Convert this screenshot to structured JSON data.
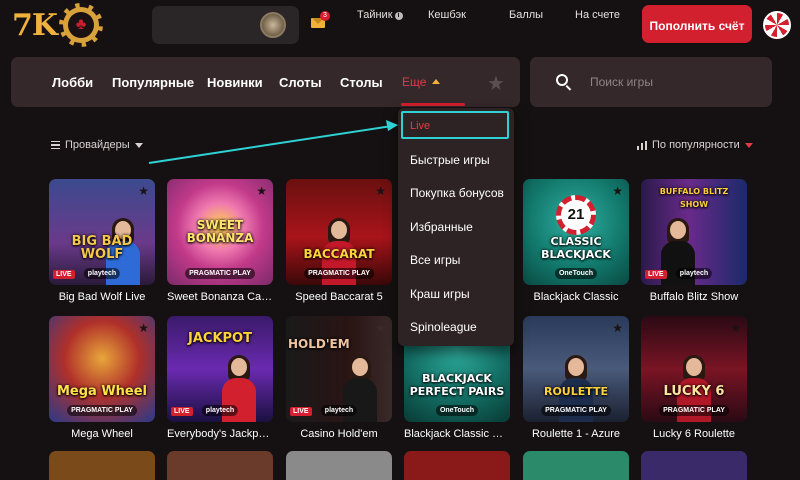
{
  "header": {
    "logo_text": "7K",
    "nav": [
      "Тайник",
      "Кешбэк",
      "Баллы",
      "На счете"
    ],
    "mail_badge": "3",
    "deposit_label": "Пополнить счёт"
  },
  "nav": {
    "items": [
      "Лобби",
      "Популярные",
      "Новинки",
      "Слоты",
      "Столы"
    ],
    "more": "Еще"
  },
  "search": {
    "placeholder": "Поиск игры"
  },
  "filters": {
    "providers": "Провайдеры",
    "sort": "По популярности"
  },
  "dropdown": {
    "items": [
      "Live",
      "Быстрые игры",
      "Покупка бонусов",
      "Избранные",
      "Все игры",
      "Краш игры",
      "Spinoleague"
    ],
    "highlight_color": "#2fd2d4"
  },
  "games": [
    {
      "name": "Big Bad Wolf Live",
      "title": "BIG BAD WOLF",
      "provider": "playtech",
      "live": true
    },
    {
      "name": "Sweet Bonanza Candy...",
      "title": "SWEET BONANZA",
      "provider": "PRAGMATIC PLAY",
      "live": false
    },
    {
      "name": "Speed Baccarat 5",
      "title": "BACCARAT",
      "provider": "PRAGMATIC PLAY",
      "live": false
    },
    {
      "name": "Blackjack Classic",
      "title": "CLASSIC BLACKJACK",
      "provider": "OneTouch",
      "live": false
    },
    {
      "name": "Buffalo Blitz Show",
      "title": "BUFFALO BLITZ SHOW",
      "provider": "playtech",
      "live": true
    },
    {
      "name": "Mega Wheel",
      "title": "Mega Wheel",
      "provider": "PRAGMATIC PLAY",
      "live": false
    },
    {
      "name": "Everybody's Jackpot Li...",
      "title": "JACKPOT",
      "provider": "playtech",
      "live": true
    },
    {
      "name": "Casino Hold'em",
      "title": "HOLD'EM",
      "provider": "playtech",
      "live": true
    },
    {
      "name": "Blackjack Classic Perf...",
      "title": "BLACKJACK PERFECT PAIRS",
      "provider": "OneTouch",
      "live": false
    },
    {
      "name": "Roulette 1 - Azure",
      "title": "ROULETTE",
      "provider": "PRAGMATIC PLAY",
      "live": false
    },
    {
      "name": "Lucky 6 Roulette",
      "title": "LUCKY 6",
      "provider": "PRAGMATIC PLAY",
      "live": false
    }
  ],
  "colors": {
    "accent": "#d3202f",
    "gold": "#f0b23a",
    "panel": "#35282a",
    "background": "#151112"
  }
}
